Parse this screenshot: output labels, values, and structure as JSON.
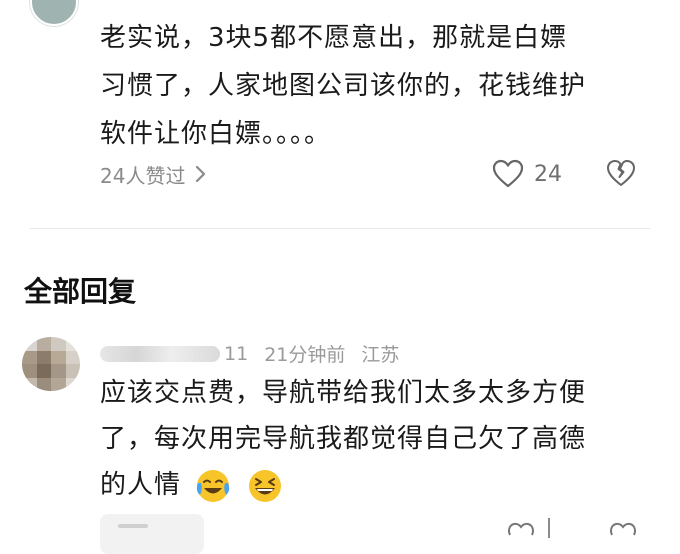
{
  "comment": {
    "lines": [
      "老实说，3块5都不愿意出，那就是白嫖",
      "习惯了，人家地图公司该你的，花钱维护",
      "软件让你白嫖。。。。"
    ],
    "likes_text": "24人赞过",
    "like_count": "24",
    "icons": {
      "chevron": "chevron-right-icon",
      "like": "heart-icon",
      "dislike": "broken-heart-icon"
    }
  },
  "section": {
    "title": "全部回复"
  },
  "reply": {
    "username_suffix": "11",
    "time": "21分钟前",
    "location": "江苏",
    "lines": [
      "应该交点费，导航带给我们太多太多方便",
      "了，每次用完导航我都觉得自己欠了高德",
      "的人情"
    ],
    "emojis": [
      "tears-of-joy-emoji-icon",
      "grinning-squinting-emoji-icon"
    ]
  },
  "colors": {
    "text": "#1a1a1a",
    "muted": "#9a9a9a",
    "divider": "#e9e9e9",
    "emoji": "#f7c52a"
  }
}
